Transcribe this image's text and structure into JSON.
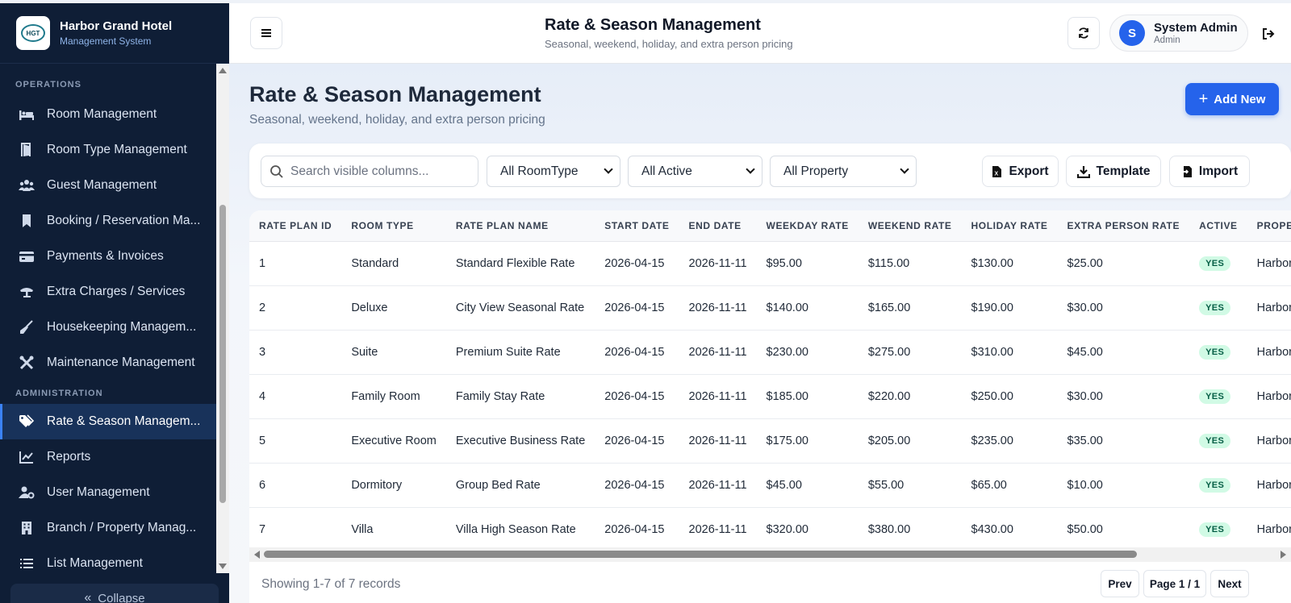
{
  "brand": {
    "title": "Harbor Grand Hotel",
    "subtitle": "Management System",
    "logo_text": "HGT"
  },
  "sidebar": {
    "sections": [
      {
        "label": "OPERATIONS",
        "items": [
          {
            "label": "Room Management",
            "icon": "bed-icon"
          },
          {
            "label": "Room Type Management",
            "icon": "door-icon"
          },
          {
            "label": "Guest Management",
            "icon": "users-icon"
          },
          {
            "label": "Booking / Reservation Ma...",
            "icon": "bookmark-icon"
          },
          {
            "label": "Payments & Invoices",
            "icon": "credit-card-icon"
          },
          {
            "label": "Extra Charges / Services",
            "icon": "bell-service-icon"
          },
          {
            "label": "Housekeeping Managem...",
            "icon": "broom-icon"
          },
          {
            "label": "Maintenance Management",
            "icon": "tools-icon"
          }
        ]
      },
      {
        "label": "ADMINISTRATION",
        "items": [
          {
            "label": "Rate & Season Managem...",
            "icon": "tags-icon",
            "active": true
          },
          {
            "label": "Reports",
            "icon": "chart-line-icon"
          },
          {
            "label": "User Management",
            "icon": "user-gear-icon"
          },
          {
            "label": "Branch / Property Manag...",
            "icon": "building-icon"
          },
          {
            "label": "List Management",
            "icon": "list-icon"
          }
        ]
      }
    ],
    "collapse_label": "Collapse"
  },
  "header": {
    "title": "Rate & Season Management",
    "subtitle": "Seasonal, weekend, holiday, and extra person pricing",
    "user_initial": "S",
    "user_name": "System Admin",
    "user_role": "Admin"
  },
  "page": {
    "title": "Rate & Season Management",
    "subtitle": "Seasonal, weekend, holiday, and extra person pricing",
    "add_label": "Add New"
  },
  "toolbar": {
    "search_placeholder": "Search visible columns...",
    "filter_roomtype": "All RoomType",
    "filter_active": "All Active",
    "filter_property": "All Property",
    "export_label": "Export",
    "template_label": "Template",
    "import_label": "Import"
  },
  "table": {
    "columns": [
      "RATE PLAN ID",
      "ROOM TYPE",
      "RATE PLAN NAME",
      "START DATE",
      "END DATE",
      "WEEKDAY RATE",
      "WEEKEND RATE",
      "HOLIDAY RATE",
      "EXTRA PERSON RATE",
      "ACTIVE",
      "PROPERTY"
    ],
    "rows": [
      [
        "1",
        "Standard",
        "Standard Flexible Rate",
        "2026-04-15",
        "2026-11-11",
        "$95.00",
        "$115.00",
        "$130.00",
        "$25.00",
        "YES",
        "Harbor Gra"
      ],
      [
        "2",
        "Deluxe",
        "City View Seasonal Rate",
        "2026-04-15",
        "2026-11-11",
        "$140.00",
        "$165.00",
        "$190.00",
        "$30.00",
        "YES",
        "Harbor Gra"
      ],
      [
        "3",
        "Suite",
        "Premium Suite Rate",
        "2026-04-15",
        "2026-11-11",
        "$230.00",
        "$275.00",
        "$310.00",
        "$45.00",
        "YES",
        "Harbor Gra"
      ],
      [
        "4",
        "Family Room",
        "Family Stay Rate",
        "2026-04-15",
        "2026-11-11",
        "$185.00",
        "$220.00",
        "$250.00",
        "$30.00",
        "YES",
        "Harbor Gra"
      ],
      [
        "5",
        "Executive Room",
        "Executive Business Rate",
        "2026-04-15",
        "2026-11-11",
        "$175.00",
        "$205.00",
        "$235.00",
        "$35.00",
        "YES",
        "Harbor Gra"
      ],
      [
        "6",
        "Dormitory",
        "Group Bed Rate",
        "2026-04-15",
        "2026-11-11",
        "$45.00",
        "$55.00",
        "$65.00",
        "$10.00",
        "YES",
        "Harbor Gra"
      ],
      [
        "7",
        "Villa",
        "Villa High Season Rate",
        "2026-04-15",
        "2026-11-11",
        "$320.00",
        "$380.00",
        "$430.00",
        "$50.00",
        "YES",
        "Harbor Gra"
      ]
    ]
  },
  "footer": {
    "showing": "Showing 1-7 of 7 records",
    "prev_label": "Prev",
    "page_label": "Page 1 / 1",
    "next_label": "Next"
  },
  "colors": {
    "sidebar_bg": "#0f1e36",
    "accent": "#2563eb",
    "active_badge_bg": "#d1fae5",
    "active_badge_fg": "#065f46"
  }
}
